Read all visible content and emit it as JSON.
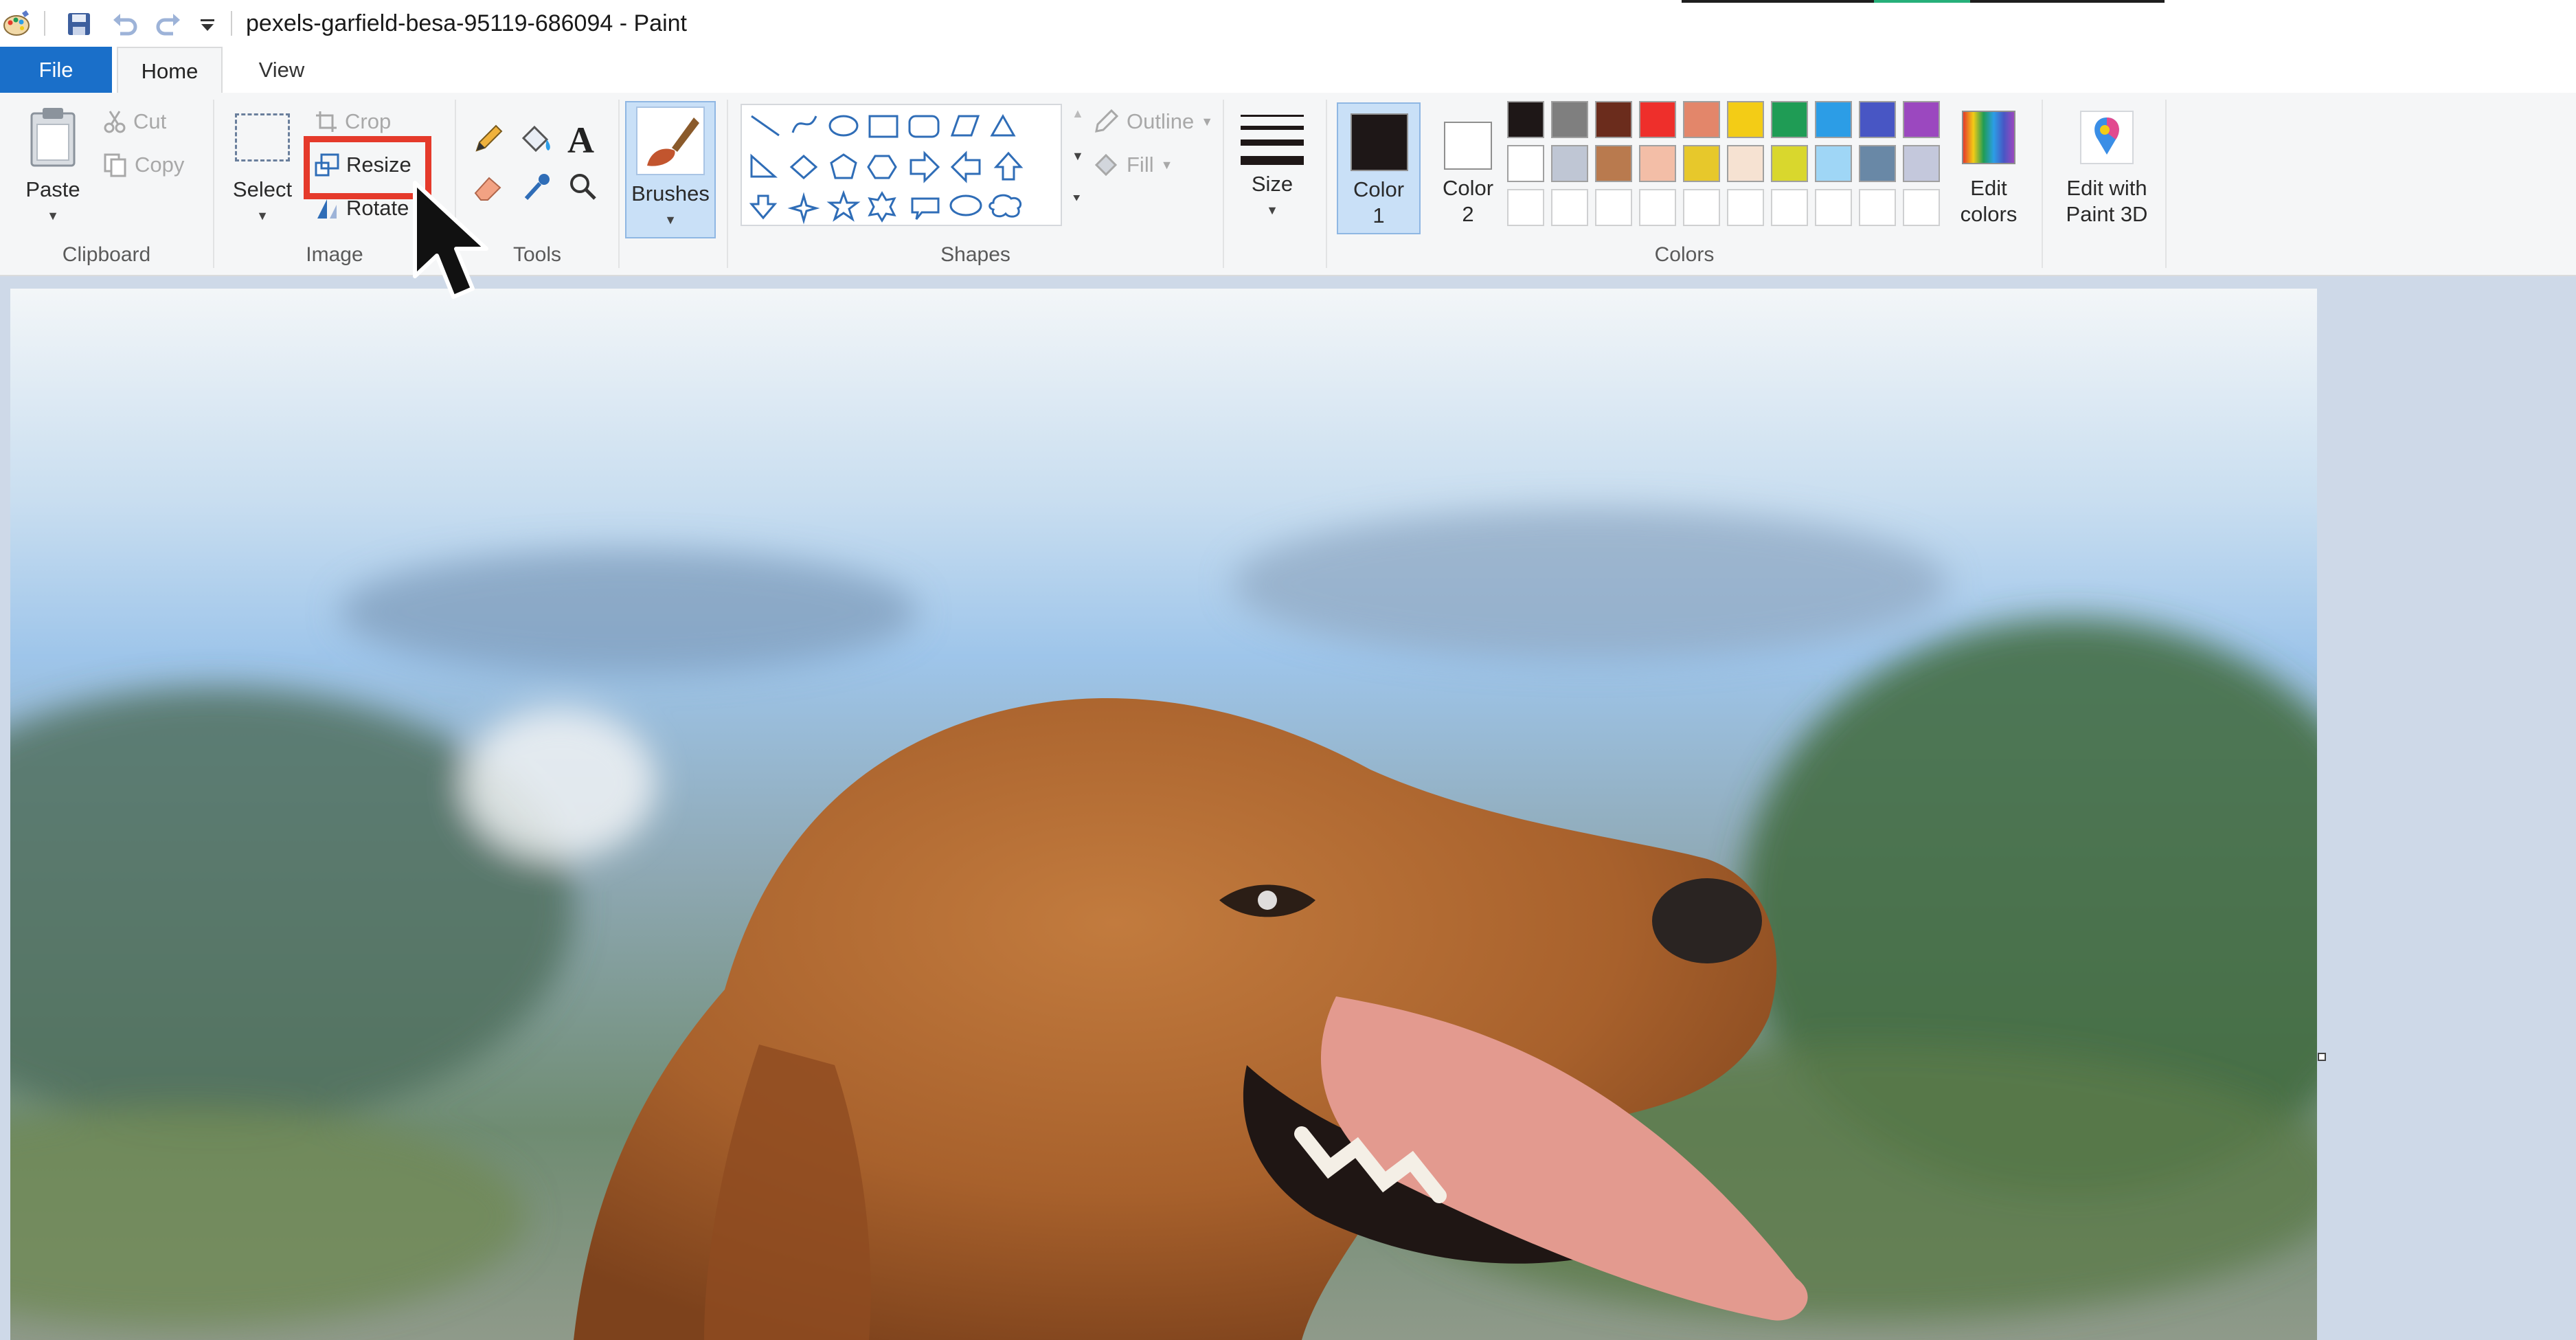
{
  "window": {
    "title": "pexels-garfield-besa-95119-686094 - Paint"
  },
  "quick_access": {
    "icons": [
      "paint-app-icon",
      "save-icon",
      "undo-icon",
      "redo-icon",
      "customize-dropdown-icon"
    ]
  },
  "tabs": [
    {
      "label": "File",
      "active": false
    },
    {
      "label": "Home",
      "active": true
    },
    {
      "label": "View",
      "active": false
    }
  ],
  "ribbon": {
    "clipboard": {
      "label": "Clipboard",
      "paste": "Paste",
      "cut": "Cut",
      "copy": "Copy"
    },
    "image": {
      "label": "Image",
      "select": "Select",
      "crop": "Crop",
      "resize": "Resize",
      "rotate": "Rotate"
    },
    "tools": {
      "label": "Tools"
    },
    "brushes": {
      "label": "Brushes"
    },
    "shapes": {
      "label": "Shapes",
      "outline": "Outline",
      "fill": "Fill"
    },
    "size": {
      "label": "Size"
    },
    "colors": {
      "label": "Colors",
      "color1_line1": "Color",
      "color1_line2": "1",
      "color2_line1": "Color",
      "color2_line2": "2",
      "color1_value": "#1e1717",
      "color2_value": "#ffffff",
      "palette_row1": [
        "#1e1717",
        "#7f7f7f",
        "#6b2c1c",
        "#ee2f2b",
        "#e3866a",
        "#f3cc16",
        "#1f9c55",
        "#2c9de6",
        "#4856c4",
        "#9b48bf"
      ],
      "palette_row2": [
        "#ffffff",
        "#bfc6d4",
        "#b97a4e",
        "#f3bea7",
        "#e7c82b",
        "#f6e2d2",
        "#d9d72d",
        "#9fd6f6",
        "#6988a6",
        "#c4c8dc"
      ],
      "edit_colors_line1": "Edit",
      "edit_colors_line2": "colors",
      "edit_paint3d_line1": "Edit with",
      "edit_paint3d_line2": "Paint 3D"
    }
  },
  "canvas": {
    "image_subject": "golden retriever dog profile"
  },
  "colors": {
    "accent_blue": "#1a6fc9",
    "highlight_red": "#e53a2b",
    "ribbon_bg": "#f5f6f7",
    "workspace_bg": "#ced9e8"
  }
}
